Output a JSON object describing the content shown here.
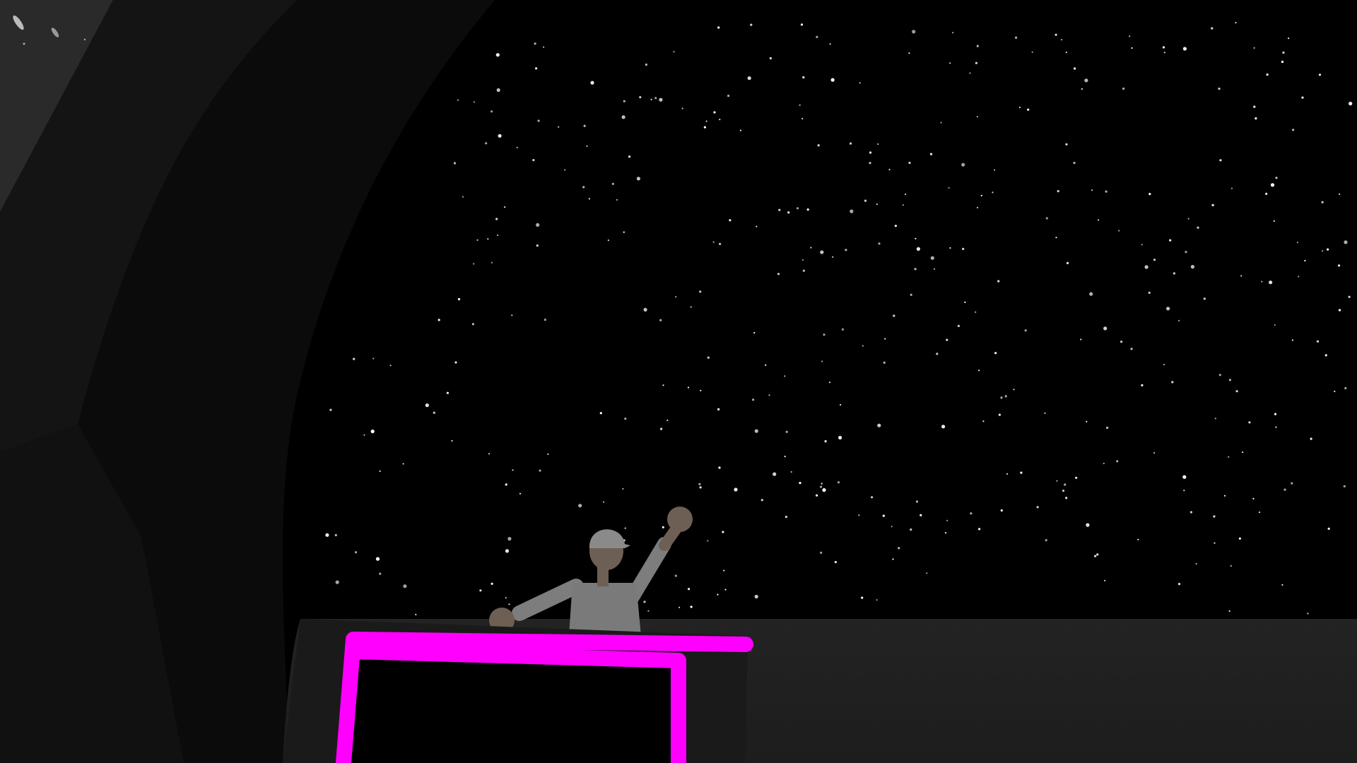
{
  "scene": {
    "kind": "3d-viewport",
    "hud_text": [],
    "colors": {
      "sky": "#000000",
      "star": "#ffffff",
      "ground": "#202020",
      "left_wall_light": "#3a3a3a",
      "left_wall_dark": "#0a0a0a",
      "object_fill": "#000000",
      "object_body": "#1c1c1c",
      "selection_outline": "#ff00ff",
      "character_shirt": "#7a7a7a",
      "character_skin": "#6e5f55",
      "character_cap": "#8a8a8a"
    },
    "elements": {
      "starfield": "starfield",
      "left_wall": "dark-wall-surface",
      "ground_plane": "ground-plane",
      "selected_object": "selected-box-object",
      "character": "waving-character"
    }
  }
}
